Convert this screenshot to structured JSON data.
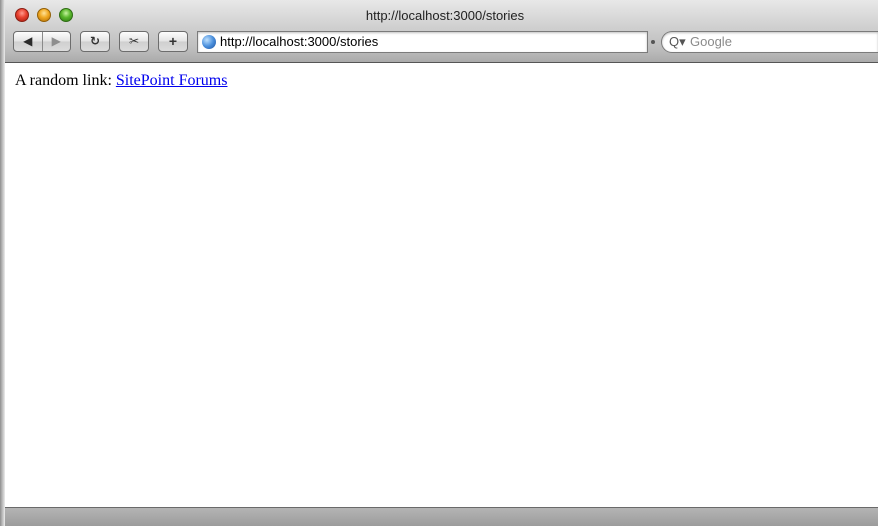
{
  "window": {
    "title": "http://localhost:3000/stories"
  },
  "toolbar": {
    "back_icon": "back-arrow-icon",
    "back_glyph": "◀",
    "forward_icon": "forward-arrow-icon",
    "forward_glyph": "▶",
    "reload_icon": "reload-icon",
    "reload_glyph": "↻",
    "snippet_icon": "snippet-icon",
    "snippet_glyph": "✂",
    "add_icon": "add-bookmark-icon",
    "add_glyph": "+"
  },
  "address_bar": {
    "icon": "globe-icon",
    "url": "http://localhost:3000/stories"
  },
  "search": {
    "icon": "search-icon",
    "glyph": "Q▾",
    "placeholder": "Google"
  },
  "page": {
    "text_prefix": "A random link: ",
    "link_text": "SitePoint Forums",
    "link_color": "#0000ee"
  }
}
